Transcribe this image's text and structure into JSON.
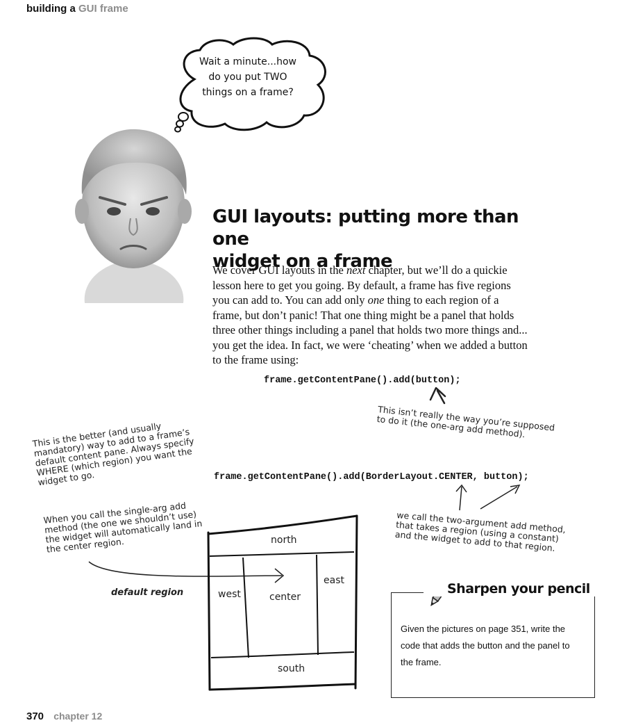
{
  "header": {
    "prefix": "building a",
    "topic": "GUI frame"
  },
  "thought_bubble": {
    "line1": "Wait a minute...how",
    "line2": "do you put TWO",
    "line3": "things on a frame?"
  },
  "section_title": {
    "line1": "GUI layouts: putting more than one",
    "line2": "widget on a frame"
  },
  "body": {
    "p1": "We cover GUI layouts in the ",
    "p1_em": "next",
    "p2": " chapter, but we’ll do a quickie lesson here to get you going. By default, a frame has five regions you can add to. You can add only ",
    "p2_em": "one",
    "p3": " thing to each region of a frame, but don’t panic! That one thing might be a panel that holds three other things including a panel that holds two more things and... you get the idea. In fact, we were ‘cheating’ when we added a button to the frame using:"
  },
  "code1": "frame.getContentPane().add(button);",
  "code2": "frame.getContentPane().add(BorderLayout.CENTER, button);",
  "annotations": {
    "not_really": {
      "line1": "This isn’t really the way you’re supposed",
      "line2": "to do it (the one-arg add method)."
    },
    "better_way": {
      "line1": "This is the better (and usually",
      "line2": "mandatory) way to add to a frame’s",
      "line3": "default content pane. Always specify",
      "line4": "WHERE (which region) you want the",
      "line5": "widget to go."
    },
    "single_arg": {
      "line1": "When you call the single-arg add",
      "line2": "method (the one we shouldn’t use)",
      "line3": "the widget will automatically land in",
      "line4": "the center region."
    },
    "two_arg": {
      "line1": "we call the two-argument add method,",
      "line2": "that takes a region (using a constant)",
      "line3": "and the widget to add to that region."
    },
    "default_region": "default region"
  },
  "regions": {
    "north": "north",
    "south": "south",
    "east": "east",
    "west": "west",
    "center": "center"
  },
  "sharpen": {
    "title": "Sharpen your pencil",
    "body": "Given the pictures on page 351, write the code that adds the button and the panel to the frame."
  },
  "footer": {
    "page": "370",
    "chapter": "chapter 12"
  }
}
